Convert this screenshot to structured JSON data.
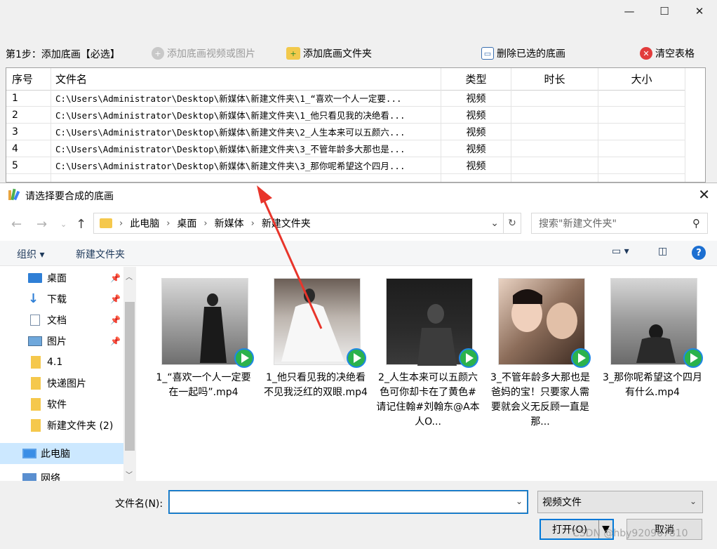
{
  "window": {
    "minimize": "—",
    "maximize": "☐",
    "close": "✕"
  },
  "toolbar": {
    "step_label": "第1步：添加底画【必选】",
    "add_video_image": "添加底画视频或图片",
    "add_folder": "添加底画文件夹",
    "delete_selected": "删除已选的底画",
    "clear_table": "清空表格"
  },
  "table": {
    "headers": [
      "序号",
      "文件名",
      "类型",
      "时长",
      "大小"
    ],
    "rows": [
      {
        "index": "1",
        "file": "C:\\Users\\Administrator\\Desktop\\新媒体\\新建文件夹\\1_“喜欢一个人一定要...",
        "type": "视频",
        "duration": "",
        "size": ""
      },
      {
        "index": "2",
        "file": "C:\\Users\\Administrator\\Desktop\\新媒体\\新建文件夹\\1_他只看见我的决绝看...",
        "type": "视频",
        "duration": "",
        "size": ""
      },
      {
        "index": "3",
        "file": "C:\\Users\\Administrator\\Desktop\\新媒体\\新建文件夹\\2_人生本来可以五颜六...",
        "type": "视频",
        "duration": "",
        "size": ""
      },
      {
        "index": "4",
        "file": "C:\\Users\\Administrator\\Desktop\\新媒体\\新建文件夹\\3_不管年龄多大那也是...",
        "type": "视频",
        "duration": "",
        "size": ""
      },
      {
        "index": "5",
        "file": "C:\\Users\\Administrator\\Desktop\\新媒体\\新建文件夹\\3_那你呢希望这个四月...",
        "type": "视频",
        "duration": "",
        "size": ""
      }
    ]
  },
  "dialog": {
    "title": "请选择要合成的底画",
    "breadcrumb": [
      "此电脑",
      "桌面",
      "新媒体",
      "新建文件夹"
    ],
    "search_placeholder": "搜索\"新建文件夹\"",
    "organize": "组织 ▾",
    "new_folder": "新建文件夹",
    "nav_items": [
      {
        "label": "桌面",
        "pinned": true
      },
      {
        "label": "下载",
        "pinned": true
      },
      {
        "label": "文档",
        "pinned": true
      },
      {
        "label": "图片",
        "pinned": true
      },
      {
        "label": "4.1",
        "pinned": false
      },
      {
        "label": "快递图片",
        "pinned": false
      },
      {
        "label": "软件",
        "pinned": false
      },
      {
        "label": "新建文件夹 (2)",
        "pinned": false
      },
      {
        "label": "此电脑",
        "pinned": false
      },
      {
        "label": "网络",
        "pinned": false
      }
    ],
    "files": [
      {
        "name": "1_“喜欢一个人一定要在一起吗”.mp4"
      },
      {
        "name": "1_他只看见我的决绝看不见我泛红的双眼.mp4"
      },
      {
        "name": "2_人生本来可以五颜六色可你却卡在了黄色#请记住翰#刘翰东@A本人O..."
      },
      {
        "name": "3_不管年龄多大那也是爸妈的宝！只要家人需要就会义无反顾一直是那..."
      },
      {
        "name": "3_那你呢希望这个四月有什么.mp4"
      }
    ],
    "filename_label": "文件名(N):",
    "filename_value": "",
    "filetype": "视频文件",
    "open_button": "打开(O)",
    "cancel_button": "取消"
  },
  "watermark": "CSDN @hby920967810",
  "colors": {
    "accent": "#0078d7",
    "arrow": "#e8352b",
    "folder": "#f5c84c"
  }
}
